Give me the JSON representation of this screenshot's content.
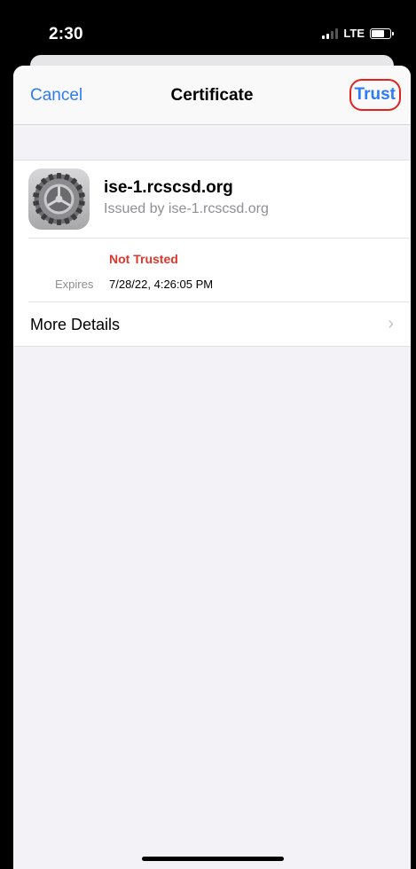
{
  "status_bar": {
    "time": "2:30",
    "network": "LTE",
    "signal_icon": "cellular-signal-icon",
    "battery_icon": "battery-icon"
  },
  "nav": {
    "cancel_label": "Cancel",
    "title": "Certificate",
    "trust_label": "Trust"
  },
  "certificate": {
    "icon": "settings-gear-icon",
    "name": "ise-1.rcscsd.org",
    "issuer": "Issued by ise-1.rcscsd.org",
    "trust_status": "Not Trusted",
    "expires_label": "Expires",
    "expires_value": "7/28/22, 4:26:05 PM"
  },
  "more_details": {
    "label": "More Details",
    "icon": "chevron-right-icon"
  },
  "colors": {
    "accent": "#2f7bf5",
    "warning": "#e0352b",
    "highlight_ring": "#e0231d"
  }
}
